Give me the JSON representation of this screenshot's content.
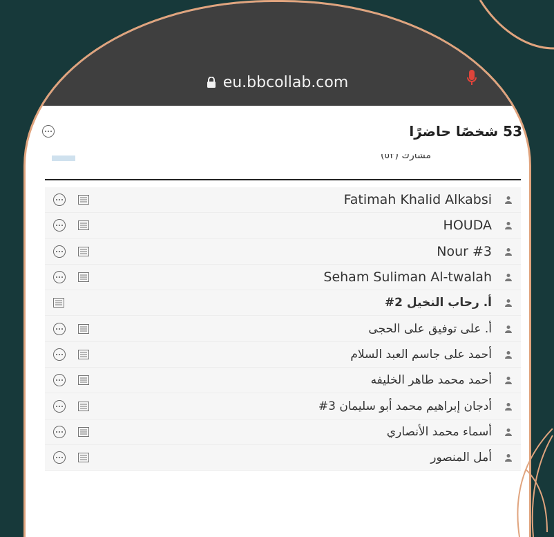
{
  "browser": {
    "url": "eu.bbcollab.com",
    "lock_icon": "lock-icon",
    "mic_icon": "microphone-icon",
    "accent": "#e0443a"
  },
  "panel": {
    "title": "53 شخصًا حاضرًا",
    "section_label": "مشارك (٥٣)"
  },
  "participants": [
    {
      "name": "Fatimah Khalid Alkabsi",
      "rtl": false,
      "bold": false,
      "more": true
    },
    {
      "name": "HOUDA",
      "rtl": false,
      "bold": false,
      "more": true
    },
    {
      "name": "Nour #3",
      "rtl": false,
      "bold": false,
      "more": true
    },
    {
      "name": "Seham Suliman Al-twalah",
      "rtl": false,
      "bold": false,
      "more": true
    },
    {
      "name": "أ. رحاب النخيل 2#",
      "rtl": true,
      "bold": true,
      "more": false
    },
    {
      "name": "أ. على توفيق على الحجى",
      "rtl": true,
      "bold": false,
      "more": true
    },
    {
      "name": "أحمد على جاسم العبد السلام",
      "rtl": true,
      "bold": false,
      "more": true
    },
    {
      "name": "أحمد محمد طاهر الخليفه",
      "rtl": true,
      "bold": false,
      "more": true
    },
    {
      "name": "أدجان إبراهيم محمد أبو سليمان 3#",
      "rtl": true,
      "bold": false,
      "more": true
    },
    {
      "name": "أسماء محمد الأنصاري",
      "rtl": true,
      "bold": false,
      "more": true
    },
    {
      "name": "أمل المنصور",
      "rtl": true,
      "bold": false,
      "more": true
    }
  ],
  "colors": {
    "background": "#17393a",
    "frame_border": "#e0a47e",
    "browser_bar": "#3f3f3f"
  }
}
